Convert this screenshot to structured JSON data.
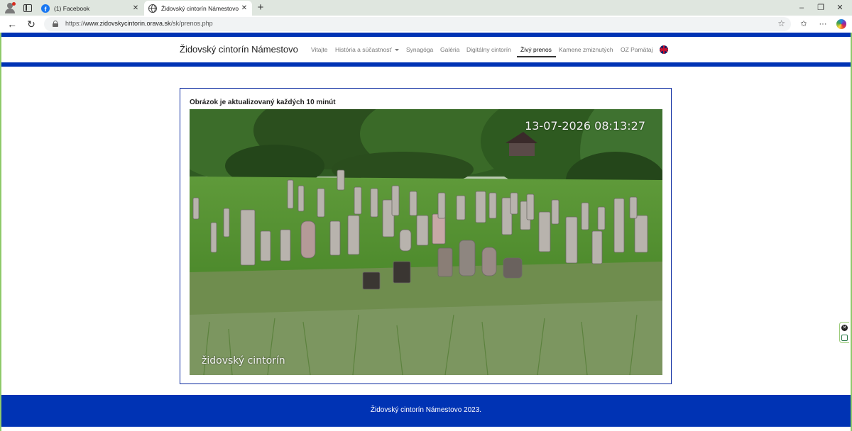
{
  "browser": {
    "tabs": [
      {
        "title": "(1) Facebook"
      },
      {
        "title": "Židovský cintorín Námestovo"
      }
    ],
    "url": {
      "prefix": "https://",
      "domain": "www.zidovskycintorin.orava.sk",
      "path": "/sk/prenos.php"
    },
    "icons": {
      "profile": "profile-icon",
      "workspaces": "workspaces-icon",
      "back": "back-arrow-icon",
      "reload": "reload-icon",
      "lock": "lock-icon",
      "favorite": "star-icon",
      "favorites_bar": "favorites-icon",
      "menu": "more-icon",
      "copilot": "copilot-icon"
    },
    "glyphs": {
      "close": "✕",
      "new_tab": "+",
      "minimize": "–",
      "restore": "❐",
      "window_close": "✕",
      "back": "←",
      "reload": "↻",
      "star": "☆",
      "favorites": "✩",
      "more": "···"
    }
  },
  "site": {
    "brand": "Židovský cintorín Námestovo",
    "nav": [
      {
        "label": "Vitajte"
      },
      {
        "label": "História a súčastnosť",
        "dropdown": true
      },
      {
        "label": "Synagóga"
      },
      {
        "label": "Galéria"
      },
      {
        "label": "Digitálny cintorín"
      },
      {
        "label": "Živý prenos",
        "active": true
      },
      {
        "label": "Kamene zmiznutých"
      },
      {
        "label": "OZ Pamätaj"
      }
    ],
    "language_icon": "uk-flag-icon",
    "colors": {
      "primary": "#0033b4",
      "card_border": "#0a2aa0"
    }
  },
  "main": {
    "card_title": "Obrázok je aktualizovaný každých 10 minút",
    "camera": {
      "timestamp": "13-07-2026 08:13:27",
      "label": "židovský cintorín"
    }
  },
  "footer": {
    "text": "Židovský cintorín Námestovo 2023."
  }
}
